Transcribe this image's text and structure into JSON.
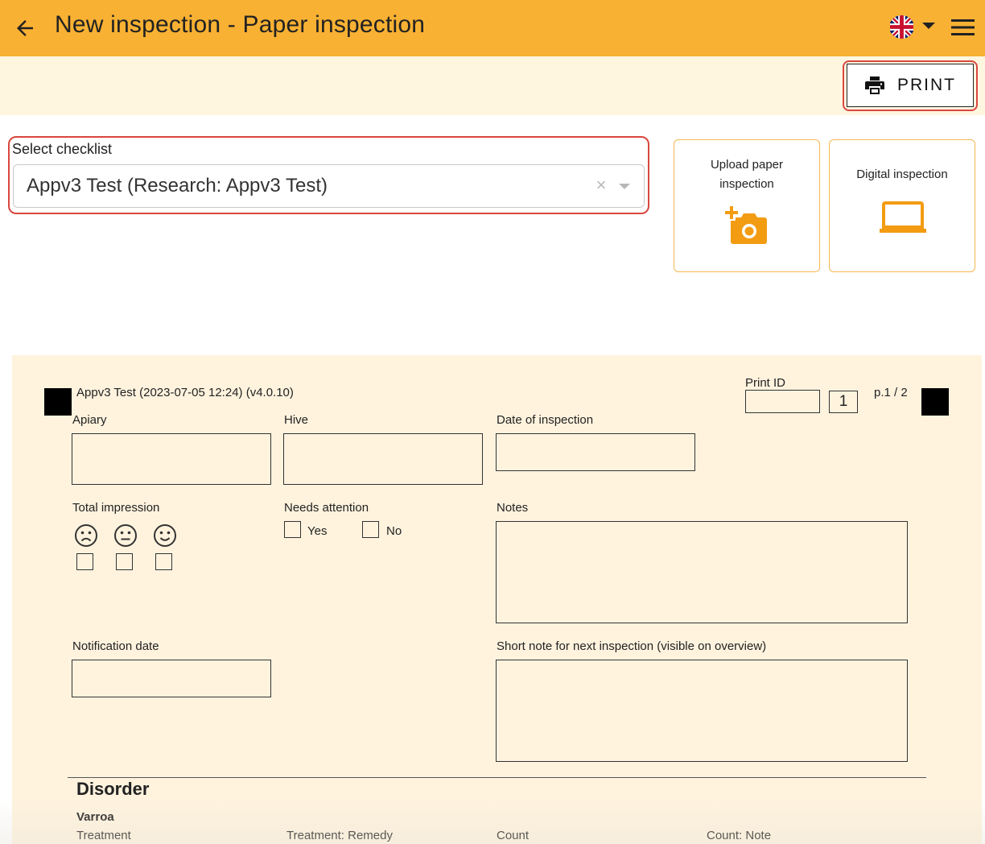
{
  "appbar": {
    "title": "New inspection - Paper inspection",
    "back_icon": "arrow-left-icon",
    "language_flag": "uk-flag-icon",
    "menu_icon": "hamburger-menu-icon",
    "color": "#f8b133"
  },
  "toolbar": {
    "print_label": "PRINT",
    "print_icon": "printer-icon"
  },
  "checklist": {
    "label": "Select checklist",
    "selected": "Appv3 Test (Research: Appv3 Test)",
    "clear_icon": "clear-x-icon",
    "caret_icon": "caret-down-icon"
  },
  "modes": {
    "upload_label": "Upload paper inspection",
    "upload_icon": "add-photo-camera-icon",
    "digital_label": "Digital inspection",
    "digital_icon": "laptop-icon",
    "accent": "#f39c12"
  },
  "paper": {
    "header": "Appv3 Test (2023-07-05 12:24) (v4.0.10)",
    "print_id_label": "Print ID",
    "page_number": "1",
    "page_label": "p.1 / 2",
    "fields": {
      "apiary": "Apiary",
      "hive": "Hive",
      "date": "Date of inspection",
      "total_impression": "Total impression",
      "needs_attention": "Needs attention",
      "yes": "Yes",
      "no": "No",
      "notes": "Notes",
      "notification_date": "Notification date",
      "short_note": "Short note for next inspection (visible on overview)"
    },
    "disorder": {
      "title": "Disorder",
      "subtitle": "Varroa",
      "columns": [
        "Treatment",
        "Treatment: Remedy",
        "Count",
        "Count: Note"
      ]
    }
  }
}
